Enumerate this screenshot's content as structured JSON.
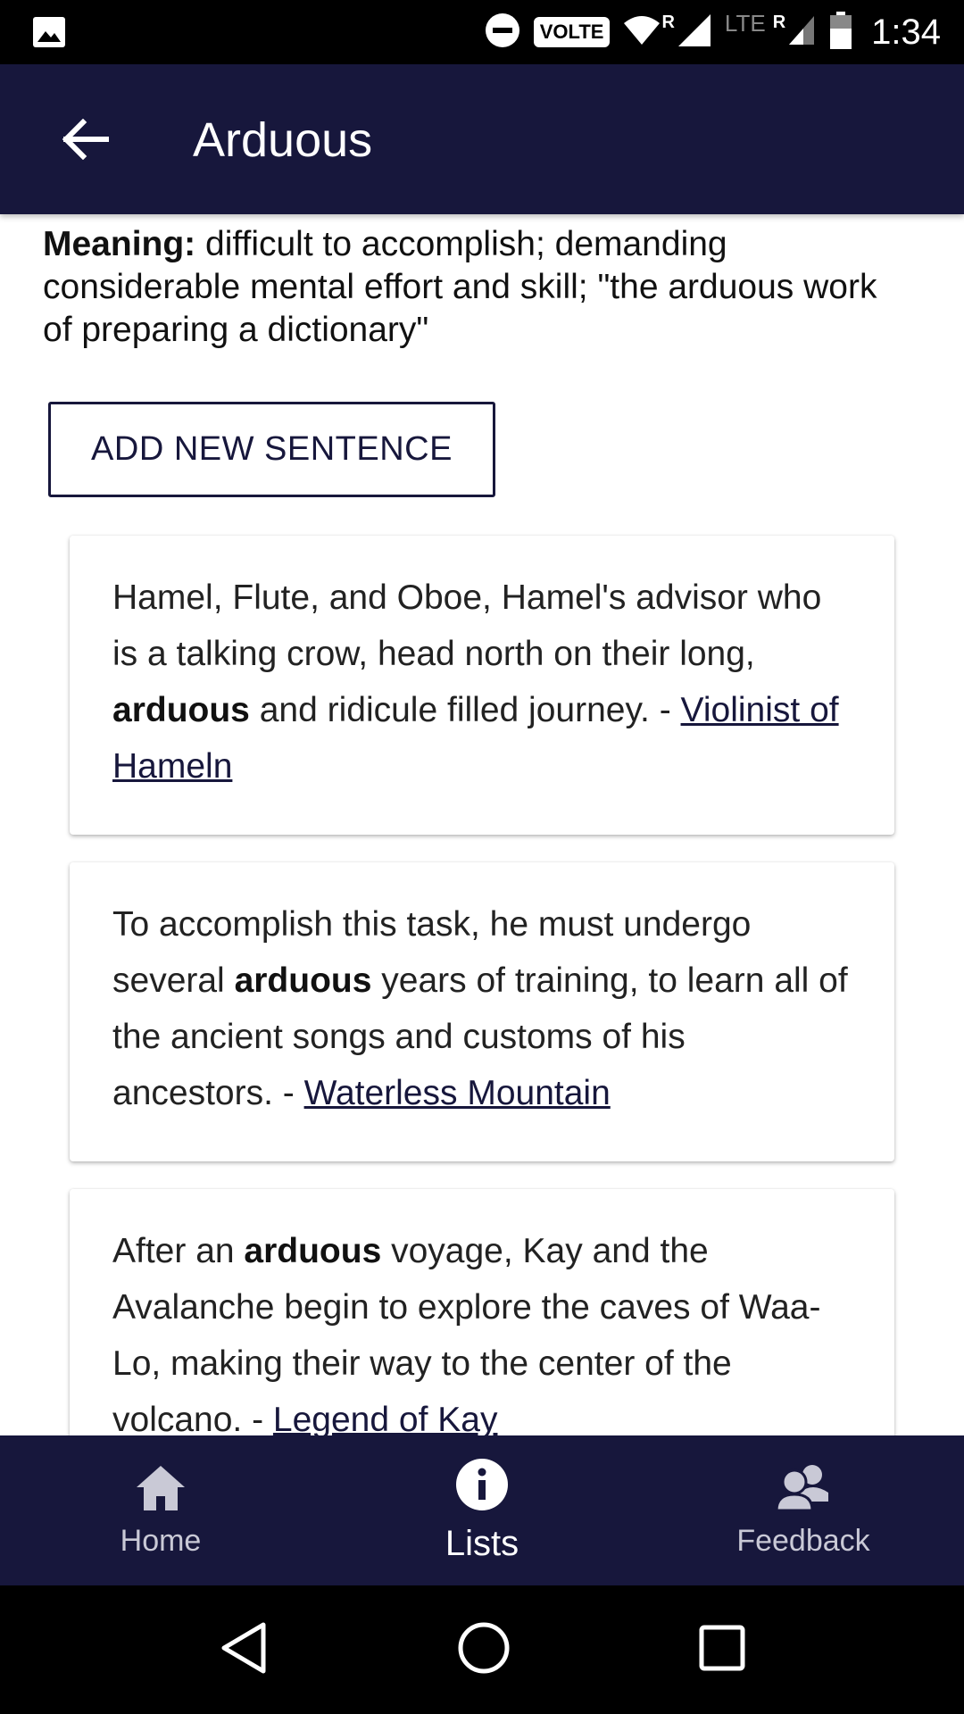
{
  "status_bar": {
    "network_label": "VOLTE",
    "network_type": "LTE",
    "roaming_indicator": "R",
    "time": "1:34"
  },
  "app_bar": {
    "title": "Arduous"
  },
  "definition": {
    "label": "Meaning:",
    "text": " difficult to accomplish; demanding considerable mental effort and skill; \"the arduous work of preparing a dictionary\""
  },
  "actions": {
    "add_sentence_label": "ADD NEW SENTENCE"
  },
  "sentences": [
    {
      "before": "Hamel, Flute, and Oboe, Hamel's advisor who is a talking crow, head north on their long, ",
      "keyword": "arduous",
      "after": " and ridicule filled journey.  - ",
      "source": "Violinist of Hameln"
    },
    {
      "before": "To accomplish this task, he must undergo several ",
      "keyword": "arduous",
      "after": " years of training, to learn all of the ancient songs and customs of his ancestors.  - ",
      "source": "Waterless Mountain"
    },
    {
      "before": "After an ",
      "keyword": "arduous",
      "after": " voyage, Kay and the Avalanche begin to explore the caves of Waa-Lo, making their way to the center of the volcano.  - ",
      "source": "Legend of Kay"
    }
  ],
  "bottom_nav": {
    "items": [
      {
        "label": "Home",
        "icon": "home-icon",
        "active": false
      },
      {
        "label": "Lists",
        "icon": "info-icon",
        "active": true
      },
      {
        "label": "Feedback",
        "icon": "people-icon",
        "active": false
      }
    ]
  },
  "colors": {
    "primary": "#17173c",
    "link": "#17173c",
    "text": "#222222",
    "inactive_nav": "#c9c9d6"
  }
}
